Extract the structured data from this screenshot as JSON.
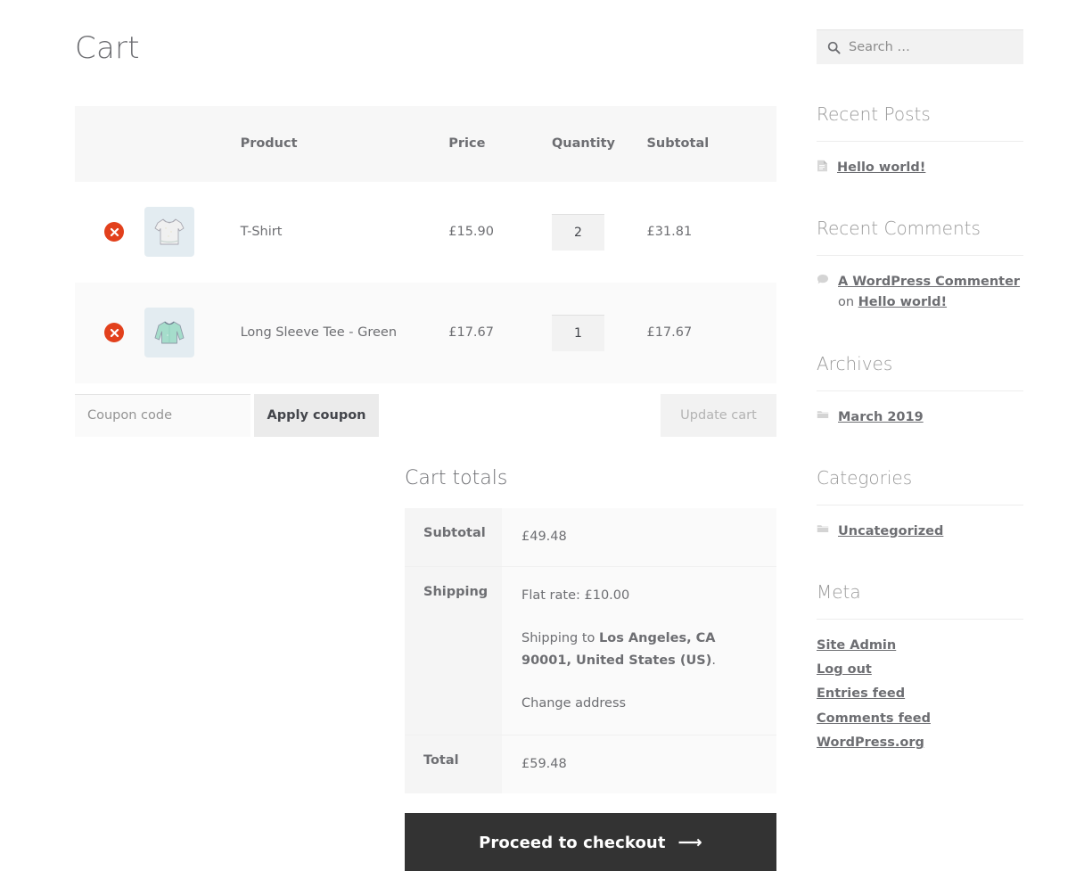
{
  "page": {
    "title": "Cart"
  },
  "cart_table": {
    "headers": {
      "remove": "",
      "thumbnail": "",
      "product": "Product",
      "price": "Price",
      "quantity": "Quantity",
      "subtotal": "Subtotal"
    },
    "items": [
      {
        "remove_label": "Remove T-Shirt from cart",
        "thumb_icon": "tshirt-thumbnail",
        "name": "T-Shirt",
        "price": "£15.90",
        "quantity": "2",
        "subtotal": "£31.81"
      },
      {
        "remove_label": "Remove Long Sleeve Tee - Green from cart",
        "thumb_icon": "long-sleeve-tee-thumbnail",
        "name": "Long Sleeve Tee - Green",
        "price": "£17.67",
        "quantity": "1",
        "subtotal": "£17.67"
      }
    ]
  },
  "actions": {
    "coupon_placeholder": "Coupon code",
    "coupon_value": "",
    "apply_coupon_label": "Apply coupon",
    "update_cart_label": "Update cart"
  },
  "totals": {
    "title": "Cart totals",
    "subtotal_label": "Subtotal",
    "subtotal_value": "£49.48",
    "shipping_label": "Shipping",
    "shipping_rate": "Flat rate: £10.00",
    "shipping_to_prefix": "Shipping to ",
    "shipping_to_address": "Los Angeles, CA 90001, United States (US)",
    "shipping_to_suffix": ".",
    "change_address_label": "Change address",
    "total_label": "Total",
    "total_value": "£59.48",
    "checkout_label": "Proceed to checkout",
    "checkout_arrow": "⟶"
  },
  "sidebar": {
    "search": {
      "placeholder": "Search …",
      "value": "",
      "icon": "search-icon"
    },
    "recent_posts": {
      "title": "Recent Posts",
      "items": [
        {
          "icon": "document-icon",
          "label": "Hello world!"
        }
      ]
    },
    "recent_comments": {
      "title": "Recent Comments",
      "items": [
        {
          "icon": "comment-bubble-icon",
          "author": "A WordPress Commenter",
          "connector": " on ",
          "post": "Hello world!"
        }
      ]
    },
    "archives": {
      "title": "Archives",
      "items": [
        {
          "icon": "folder-icon",
          "label": "March 2019"
        }
      ]
    },
    "categories": {
      "title": "Categories",
      "items": [
        {
          "icon": "folder-icon",
          "label": "Uncategorized"
        }
      ]
    },
    "meta": {
      "title": "Meta",
      "items": [
        {
          "label": "Site Admin"
        },
        {
          "label": "Log out"
        },
        {
          "label": "Entries feed"
        },
        {
          "label": "Comments feed"
        },
        {
          "label": "WordPress.org"
        }
      ]
    }
  },
  "colors": {
    "remove_badge": "#e2401c",
    "checkout_button": "#333333",
    "thumb_background": "#e3ecf1",
    "tee_green": "#a5ddcb",
    "header_row": "#f7f7f7",
    "stripe_row": "#fafafa",
    "text": "#6d6e72"
  }
}
